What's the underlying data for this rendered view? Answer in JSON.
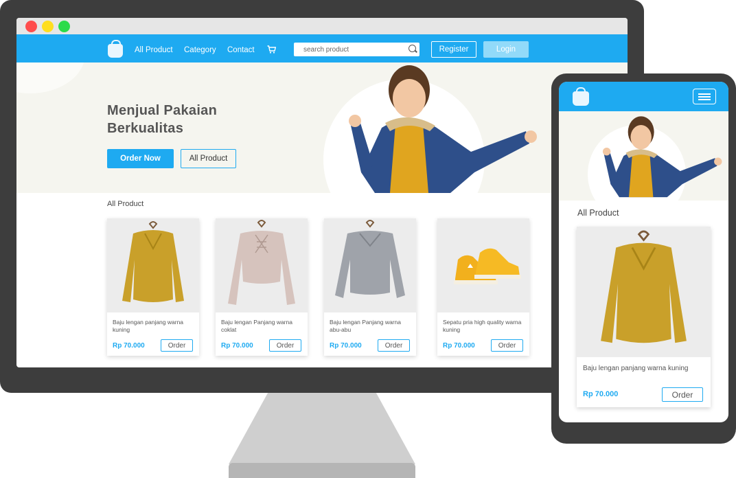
{
  "colors": {
    "accent": "#1eaaf1",
    "login_button": "#92daf9",
    "hero_bg": "#f5f5ef",
    "device_frame": "#3d3d3d",
    "sweater_yellow": "#c9a02a",
    "sweater_pink": "#d6c3bd",
    "sweater_gray": "#9fa3aa",
    "shoe_yellow": "#f2b01d"
  },
  "desktop": {
    "nav": {
      "logo_icon": "shopping-bag-icon",
      "links": [
        "All Product",
        "Category",
        "Contact"
      ],
      "cart_icon": "cart-icon",
      "search_placeholder": "search product",
      "register_label": "Register",
      "login_label": "Login"
    },
    "hero": {
      "title": "Menjual Pakaian Berkualitas",
      "order_now_label": "Order Now",
      "all_product_label": "All Product"
    },
    "products_title": "All Product",
    "products": [
      {
        "name": "Baju lengan panjang warna kuning",
        "price": "Rp 70.000",
        "order_label": "Order",
        "image": "yellow-sweater"
      },
      {
        "name": "Baju lengan Panjang warna coklat",
        "price": "Rp 70.000",
        "order_label": "Order",
        "image": "pink-sweater"
      },
      {
        "name": "Baju lengan Panjang warna abu-abu",
        "price": "Rp 70.000",
        "order_label": "Order",
        "image": "gray-sweater"
      },
      {
        "name": "Sepatu pria high quality warna kuning",
        "price": "Rp 70.000",
        "order_label": "Order",
        "image": "yellow-sneakers"
      }
    ]
  },
  "mobile": {
    "logo_icon": "shopping-bag-icon",
    "menu_icon": "hamburger-menu-icon",
    "products_title": "All Product",
    "product": {
      "name": "Baju lengan panjang warna kuning",
      "price": "Rp 70.000",
      "order_label": "Order",
      "image": "yellow-sweater"
    }
  }
}
